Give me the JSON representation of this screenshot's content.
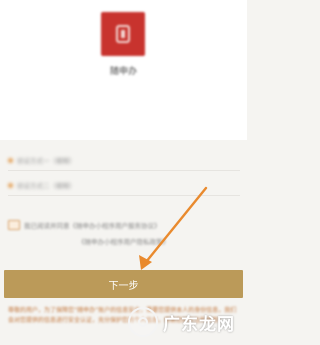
{
  "app": {
    "name": "随申办"
  },
  "options": [
    {
      "label": "验证方式一（模糊）"
    },
    {
      "label": "验证方式二（模糊）"
    }
  ],
  "agreement": {
    "text": "我已阅读并同意《随申办小程序用户服务协议》",
    "policy": "《随申办小程序用户隐私政策》"
  },
  "buttons": {
    "next": "下一步"
  },
  "notice": {
    "text": "尊敬的用户，为了保障您“随申办”账户的信息安全，需要您提供本人的身份信息，我们会对您提供的信息进行安全认证，充分保护您的个人信息，感谢您的关注和使用！"
  },
  "watermark": {
    "text": "广东龙网"
  },
  "colors": {
    "brand_red": "#c8332e",
    "button_gold": "#bb9a59",
    "accent_orange": "#e07a2a",
    "notice_text": "#c2753a"
  }
}
